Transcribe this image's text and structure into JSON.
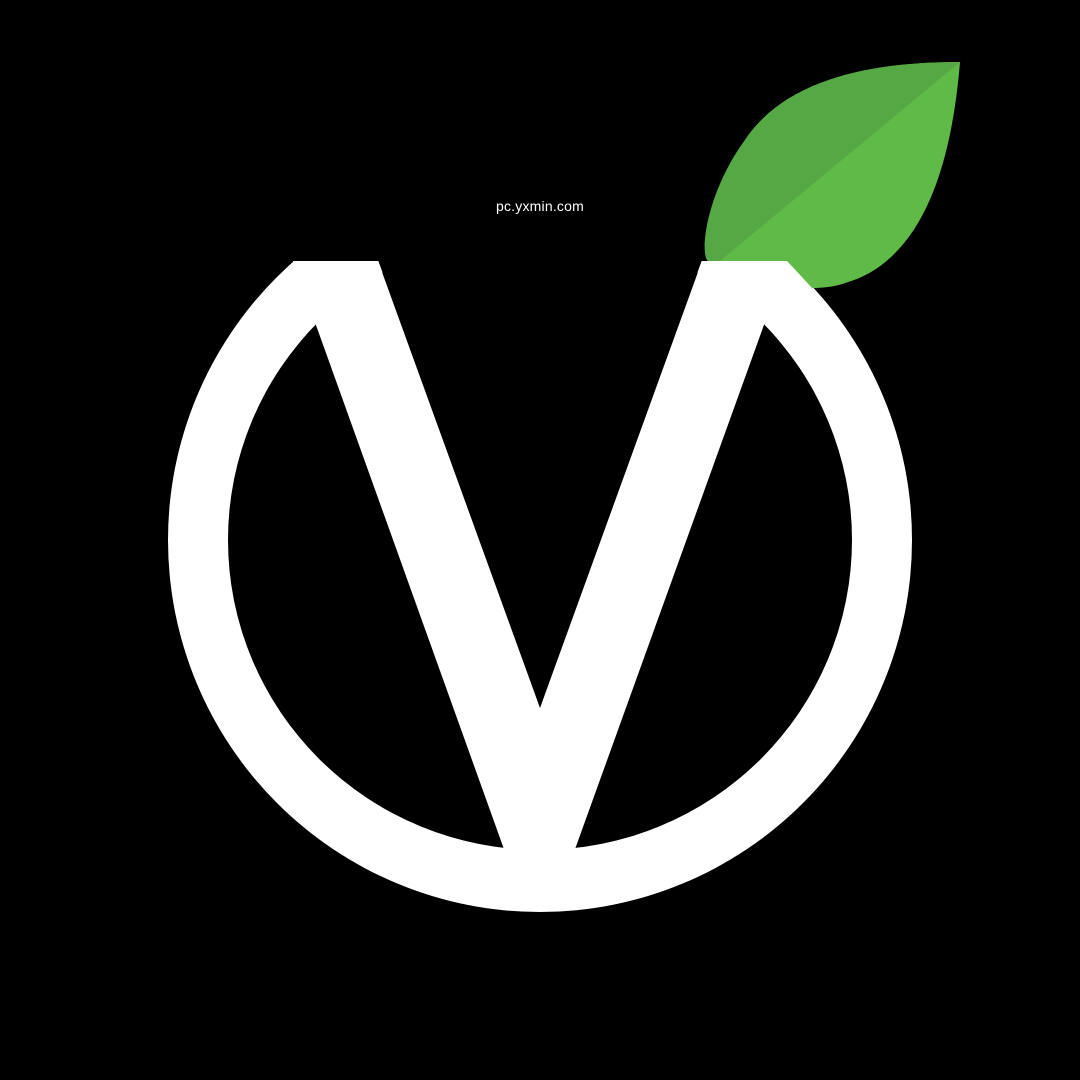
{
  "watermark": {
    "text": "pc.yxmin.com"
  },
  "logo": {
    "icon": "v-leaf-logo-icon",
    "colors": {
      "background": "#000000",
      "mark": "#ffffff",
      "leaf_light": "#5fba47",
      "leaf_dark": "#56a844"
    }
  }
}
